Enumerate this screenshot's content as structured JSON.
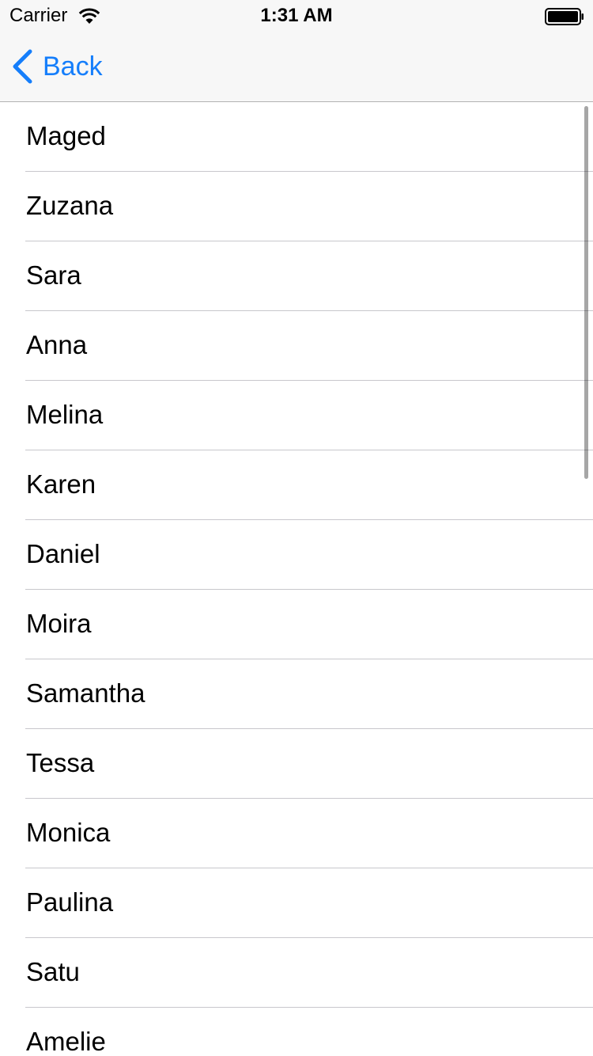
{
  "status_bar": {
    "carrier": "Carrier",
    "time": "1:31 AM",
    "wifi_icon": "wifi-icon",
    "battery_icon": "battery-icon"
  },
  "nav": {
    "back_label": "Back",
    "back_icon": "chevron-left-icon",
    "accent_color": "#157efb"
  },
  "list": {
    "items": [
      "Maged",
      "Zuzana",
      "Sara",
      "Anna",
      "Melina",
      "Karen",
      "Daniel",
      "Moira",
      "Samantha",
      "Tessa",
      "Monica",
      "Paulina",
      "Satu",
      "Amelie"
    ]
  }
}
